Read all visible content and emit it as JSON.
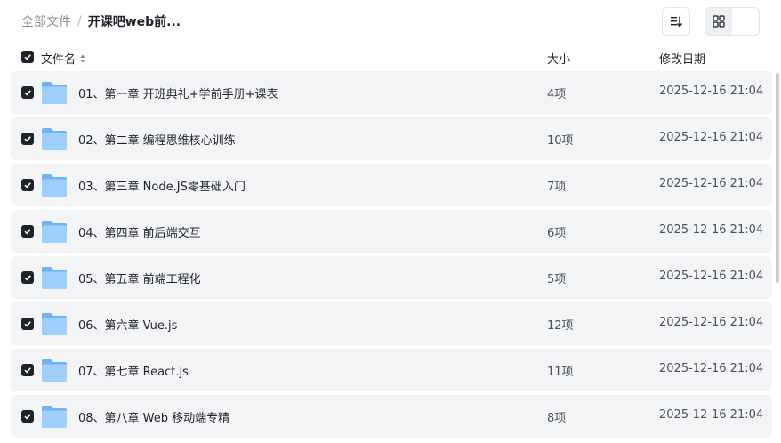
{
  "breadcrumb": {
    "root": "全部文件",
    "separator": "/",
    "current": "开课吧web前..."
  },
  "toolbar": {
    "sort_icon": "sort-lines-icon",
    "list_view_icon": "list-view-icon",
    "grid_view_icon": "grid-view-icon"
  },
  "columns": {
    "name": "文件名",
    "size": "大小",
    "modified": "修改日期"
  },
  "rows": [
    {
      "name": "01、第一章 开班典礼+学前手册+课表",
      "size": "4项",
      "date": "2025-12-16 21:04"
    },
    {
      "name": "02、第二章 编程思维核心训练",
      "size": "10项",
      "date": "2025-12-16 21:04"
    },
    {
      "name": "03、第三章 Node.JS零基础入门",
      "size": "7项",
      "date": "2025-12-16 21:04"
    },
    {
      "name": "04、第四章 前后端交互",
      "size": "6项",
      "date": "2025-12-16 21:04"
    },
    {
      "name": "05、第五章 前端工程化",
      "size": "5项",
      "date": "2025-12-16 21:04"
    },
    {
      "name": "06、第六章 Vue.js",
      "size": "12项",
      "date": "2025-12-16 21:04"
    },
    {
      "name": "07、第七章 React.js",
      "size": "11项",
      "date": "2025-12-16 21:04"
    },
    {
      "name": "08、第八章 Web 移动端专精",
      "size": "8项",
      "date": "2025-12-16 21:04"
    }
  ],
  "colors": {
    "folder_back": "#6fb3f3",
    "folder_front": "#9fd0fb",
    "checkbox": "#1f2329",
    "row_bg": "#f3f4f6"
  }
}
